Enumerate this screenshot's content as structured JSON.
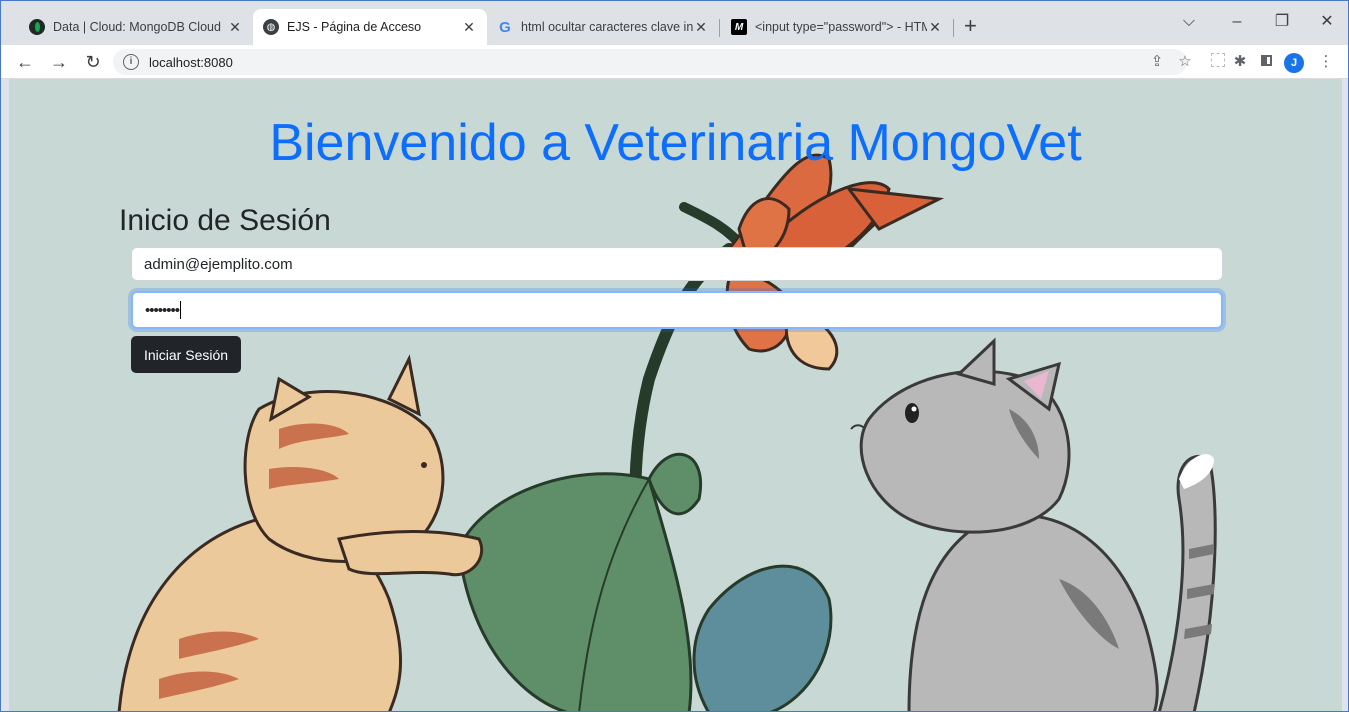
{
  "tabs": [
    {
      "title": "Data | Cloud: MongoDB Cloud",
      "favicon": "mongodb-leaf-icon",
      "active": false
    },
    {
      "title": "EJS - Página de Acceso",
      "favicon": "globe-icon",
      "active": true
    },
    {
      "title": "html ocultar caracteres clave inpu",
      "favicon": "google-g-icon",
      "active": false
    },
    {
      "title": "<input type=\"password\"> - HTM",
      "favicon": "mdn-m-icon",
      "active": false
    }
  ],
  "newtab_symbol": "+",
  "window_controls": {
    "collapse": "⌵",
    "minimize": "–",
    "restore": "❐",
    "close": "✕"
  },
  "address": {
    "info_symbol": "i",
    "url": "localhost:8080"
  },
  "profile_initial": "J",
  "page": {
    "heading": "Bienvenido a Veterinaria MongoVet",
    "login_title": "Inicio de Sesión",
    "email_value": "admin@ejemplito.com",
    "password_masked": "••••••••",
    "submit_label": "Iniciar Sesión"
  },
  "colors": {
    "heading": "#0d6efd",
    "page_background": "#c8d9d5",
    "button": "#212529"
  }
}
